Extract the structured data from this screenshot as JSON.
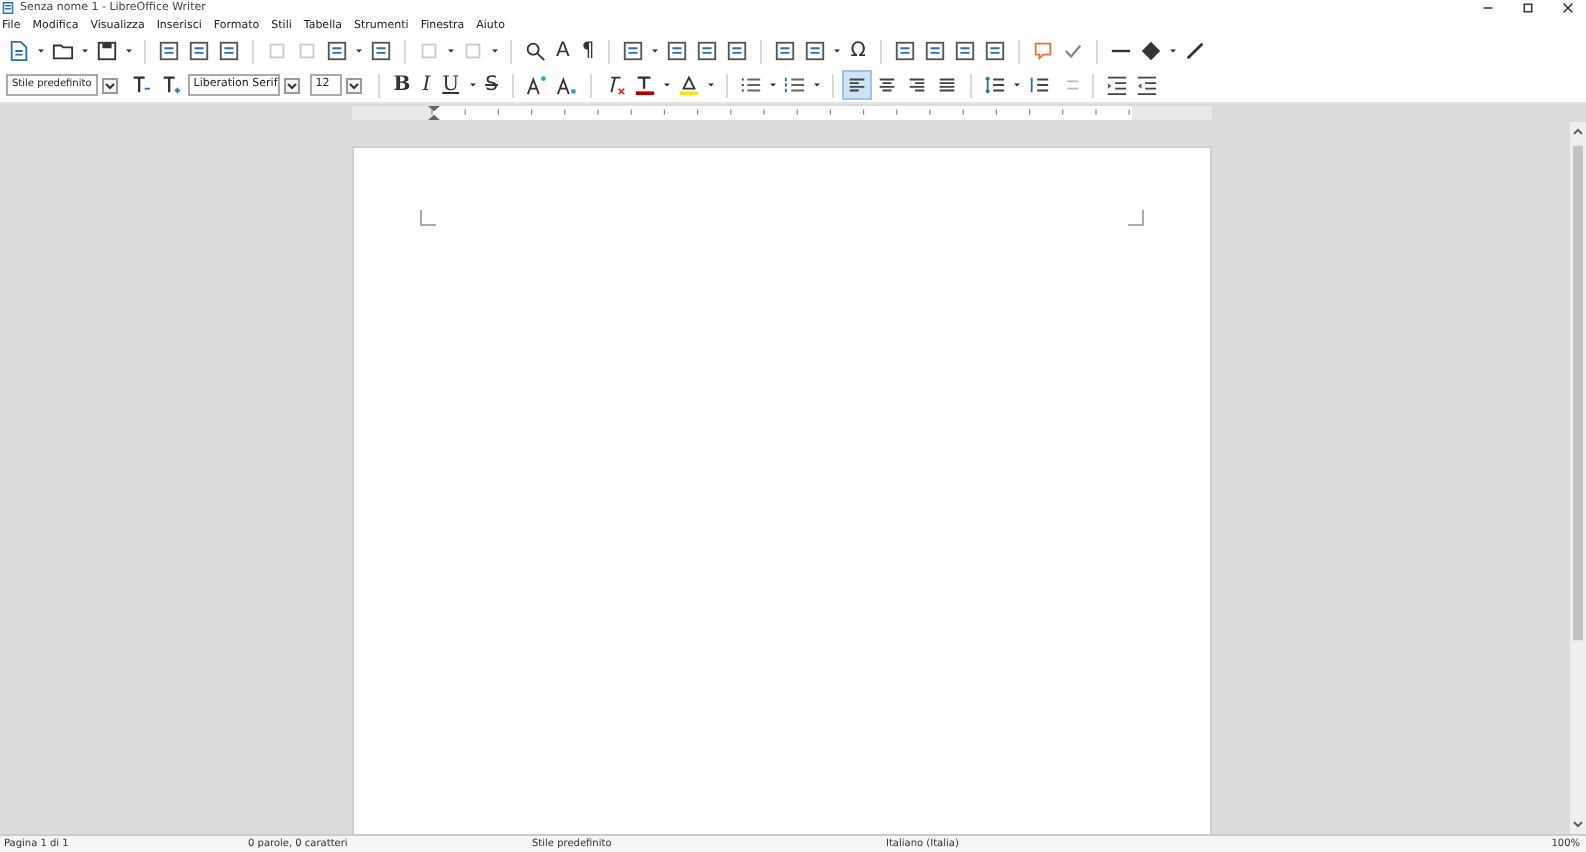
{
  "window": {
    "title": "Senza nome 1 - LibreOffice Writer"
  },
  "menu": [
    "File",
    "Modifica",
    "Visualizza",
    "Inserisci",
    "Formato",
    "Stili",
    "Tabella",
    "Strumenti",
    "Finestra",
    "Aiuto"
  ],
  "toolbar_glyphs": [
    "A",
    "¶",
    "Ω"
  ],
  "formatting": {
    "paragraph_style": "Stile predefinito",
    "font": "Liberation Serif",
    "size": "12",
    "bold": "B",
    "italic": "I",
    "underline": "U",
    "strikethrough": "S",
    "alignment": [
      {
        "selected": true
      },
      {
        "selected": false
      },
      {
        "selected": false
      },
      {
        "selected": false
      }
    ]
  },
  "status_bar": [
    {
      "text": "Pagina 1 di 1"
    },
    {
      "text": "0 parole, 0 caratteri"
    },
    {
      "text": "Stile predefinito"
    },
    {
      "text": "Italiano (Italia)"
    },
    {
      "text": "100%"
    }
  ]
}
